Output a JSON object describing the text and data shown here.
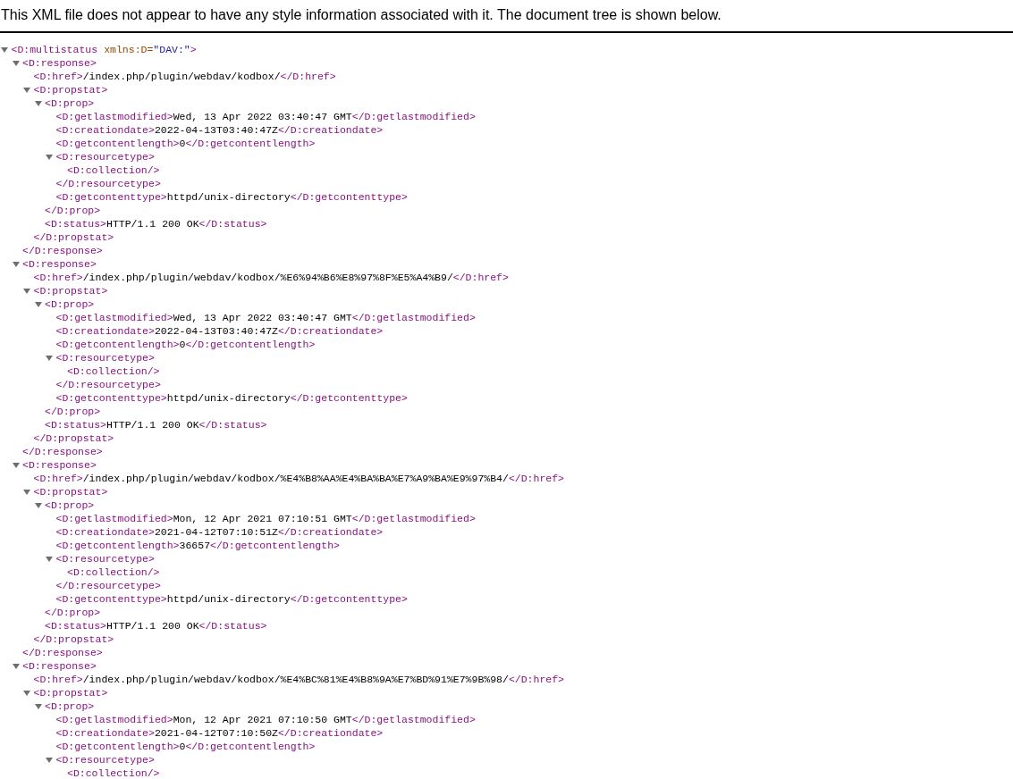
{
  "banner": "This XML file does not appear to have any style information associated with it. The document tree is shown below.",
  "tree": {
    "open": "<D:multistatus",
    "attribute": {
      "name": "xmlns:D=",
      "value": "\"DAV:\""
    },
    "open_end": ">",
    "expanded": true,
    "children": [
      {
        "open": "<D:response>",
        "close": "</D:response>",
        "expanded": true,
        "children": [
          {
            "open": "<D:href>",
            "text": "/index.php/plugin/webdav/kodbox/",
            "close": "</D:href>"
          },
          {
            "open": "<D:propstat>",
            "close": "</D:propstat>",
            "expanded": true,
            "children": [
              {
                "open": "<D:prop>",
                "close": "</D:prop>",
                "expanded": true,
                "children": [
                  {
                    "open": "<D:getlastmodified>",
                    "text": "Wed, 13 Apr 2022 03:40:47 GMT",
                    "close": "</D:getlastmodified>"
                  },
                  {
                    "open": "<D:creationdate>",
                    "text": "2022-04-13T03:40:47Z",
                    "close": "</D:creationdate>"
                  },
                  {
                    "open": "<D:getcontentlength>",
                    "text": "0",
                    "close": "</D:getcontentlength>"
                  },
                  {
                    "open": "<D:resourcetype>",
                    "close": "</D:resourcetype>",
                    "expanded": true,
                    "children": [
                      {
                        "open": "<D:collection/>"
                      }
                    ]
                  },
                  {
                    "open": "<D:getcontenttype>",
                    "text": "httpd/unix-directory",
                    "close": "</D:getcontenttype>"
                  }
                ]
              },
              {
                "open": "<D:status>",
                "text": "HTTP/1.1 200 OK",
                "close": "</D:status>"
              }
            ]
          }
        ]
      },
      {
        "open": "<D:response>",
        "close": "</D:response>",
        "expanded": true,
        "children": [
          {
            "open": "<D:href>",
            "text": "/index.php/plugin/webdav/kodbox/%E6%94%B6%E8%97%8F%E5%A4%B9/",
            "close": "</D:href>"
          },
          {
            "open": "<D:propstat>",
            "close": "</D:propstat>",
            "expanded": true,
            "children": [
              {
                "open": "<D:prop>",
                "close": "</D:prop>",
                "expanded": true,
                "children": [
                  {
                    "open": "<D:getlastmodified>",
                    "text": "Wed, 13 Apr 2022 03:40:47 GMT",
                    "close": "</D:getlastmodified>"
                  },
                  {
                    "open": "<D:creationdate>",
                    "text": "2022-04-13T03:40:47Z",
                    "close": "</D:creationdate>"
                  },
                  {
                    "open": "<D:getcontentlength>",
                    "text": "0",
                    "close": "</D:getcontentlength>"
                  },
                  {
                    "open": "<D:resourcetype>",
                    "close": "</D:resourcetype>",
                    "expanded": true,
                    "children": [
                      {
                        "open": "<D:collection/>"
                      }
                    ]
                  },
                  {
                    "open": "<D:getcontenttype>",
                    "text": "httpd/unix-directory",
                    "close": "</D:getcontenttype>"
                  }
                ]
              },
              {
                "open": "<D:status>",
                "text": "HTTP/1.1 200 OK",
                "close": "</D:status>"
              }
            ]
          }
        ]
      },
      {
        "open": "<D:response>",
        "close": "</D:response>",
        "expanded": true,
        "children": [
          {
            "open": "<D:href>",
            "text": "/index.php/plugin/webdav/kodbox/%E4%B8%AA%E4%BA%BA%E7%A9%BA%E9%97%B4/",
            "close": "</D:href>"
          },
          {
            "open": "<D:propstat>",
            "close": "</D:propstat>",
            "expanded": true,
            "children": [
              {
                "open": "<D:prop>",
                "close": "</D:prop>",
                "expanded": true,
                "children": [
                  {
                    "open": "<D:getlastmodified>",
                    "text": "Mon, 12 Apr 2021 07:10:51 GMT",
                    "close": "</D:getlastmodified>"
                  },
                  {
                    "open": "<D:creationdate>",
                    "text": "2021-04-12T07:10:51Z",
                    "close": "</D:creationdate>"
                  },
                  {
                    "open": "<D:getcontentlength>",
                    "text": "36657",
                    "close": "</D:getcontentlength>"
                  },
                  {
                    "open": "<D:resourcetype>",
                    "close": "</D:resourcetype>",
                    "expanded": true,
                    "children": [
                      {
                        "open": "<D:collection/>"
                      }
                    ]
                  },
                  {
                    "open": "<D:getcontenttype>",
                    "text": "httpd/unix-directory",
                    "close": "</D:getcontenttype>"
                  }
                ]
              },
              {
                "open": "<D:status>",
                "text": "HTTP/1.1 200 OK",
                "close": "</D:status>"
              }
            ]
          }
        ]
      },
      {
        "open": "<D:response>",
        "expanded": true,
        "children": [
          {
            "open": "<D:href>",
            "text": "/index.php/plugin/webdav/kodbox/%E4%BC%81%E4%B8%9A%E7%BD%91%E7%9B%98/",
            "close": "</D:href>"
          },
          {
            "open": "<D:propstat>",
            "expanded": true,
            "children": [
              {
                "open": "<D:prop>",
                "expanded": true,
                "children": [
                  {
                    "open": "<D:getlastmodified>",
                    "text": "Mon, 12 Apr 2021 07:10:50 GMT",
                    "close": "</D:getlastmodified>"
                  },
                  {
                    "open": "<D:creationdate>",
                    "text": "2021-04-12T07:10:50Z",
                    "close": "</D:creationdate>"
                  },
                  {
                    "open": "<D:getcontentlength>",
                    "text": "0",
                    "close": "</D:getcontentlength>"
                  },
                  {
                    "open": "<D:resourcetype>",
                    "expanded": true,
                    "children": [
                      {
                        "open": "<D:collection/>"
                      }
                    ]
                  }
                ]
              }
            ]
          }
        ]
      }
    ]
  }
}
